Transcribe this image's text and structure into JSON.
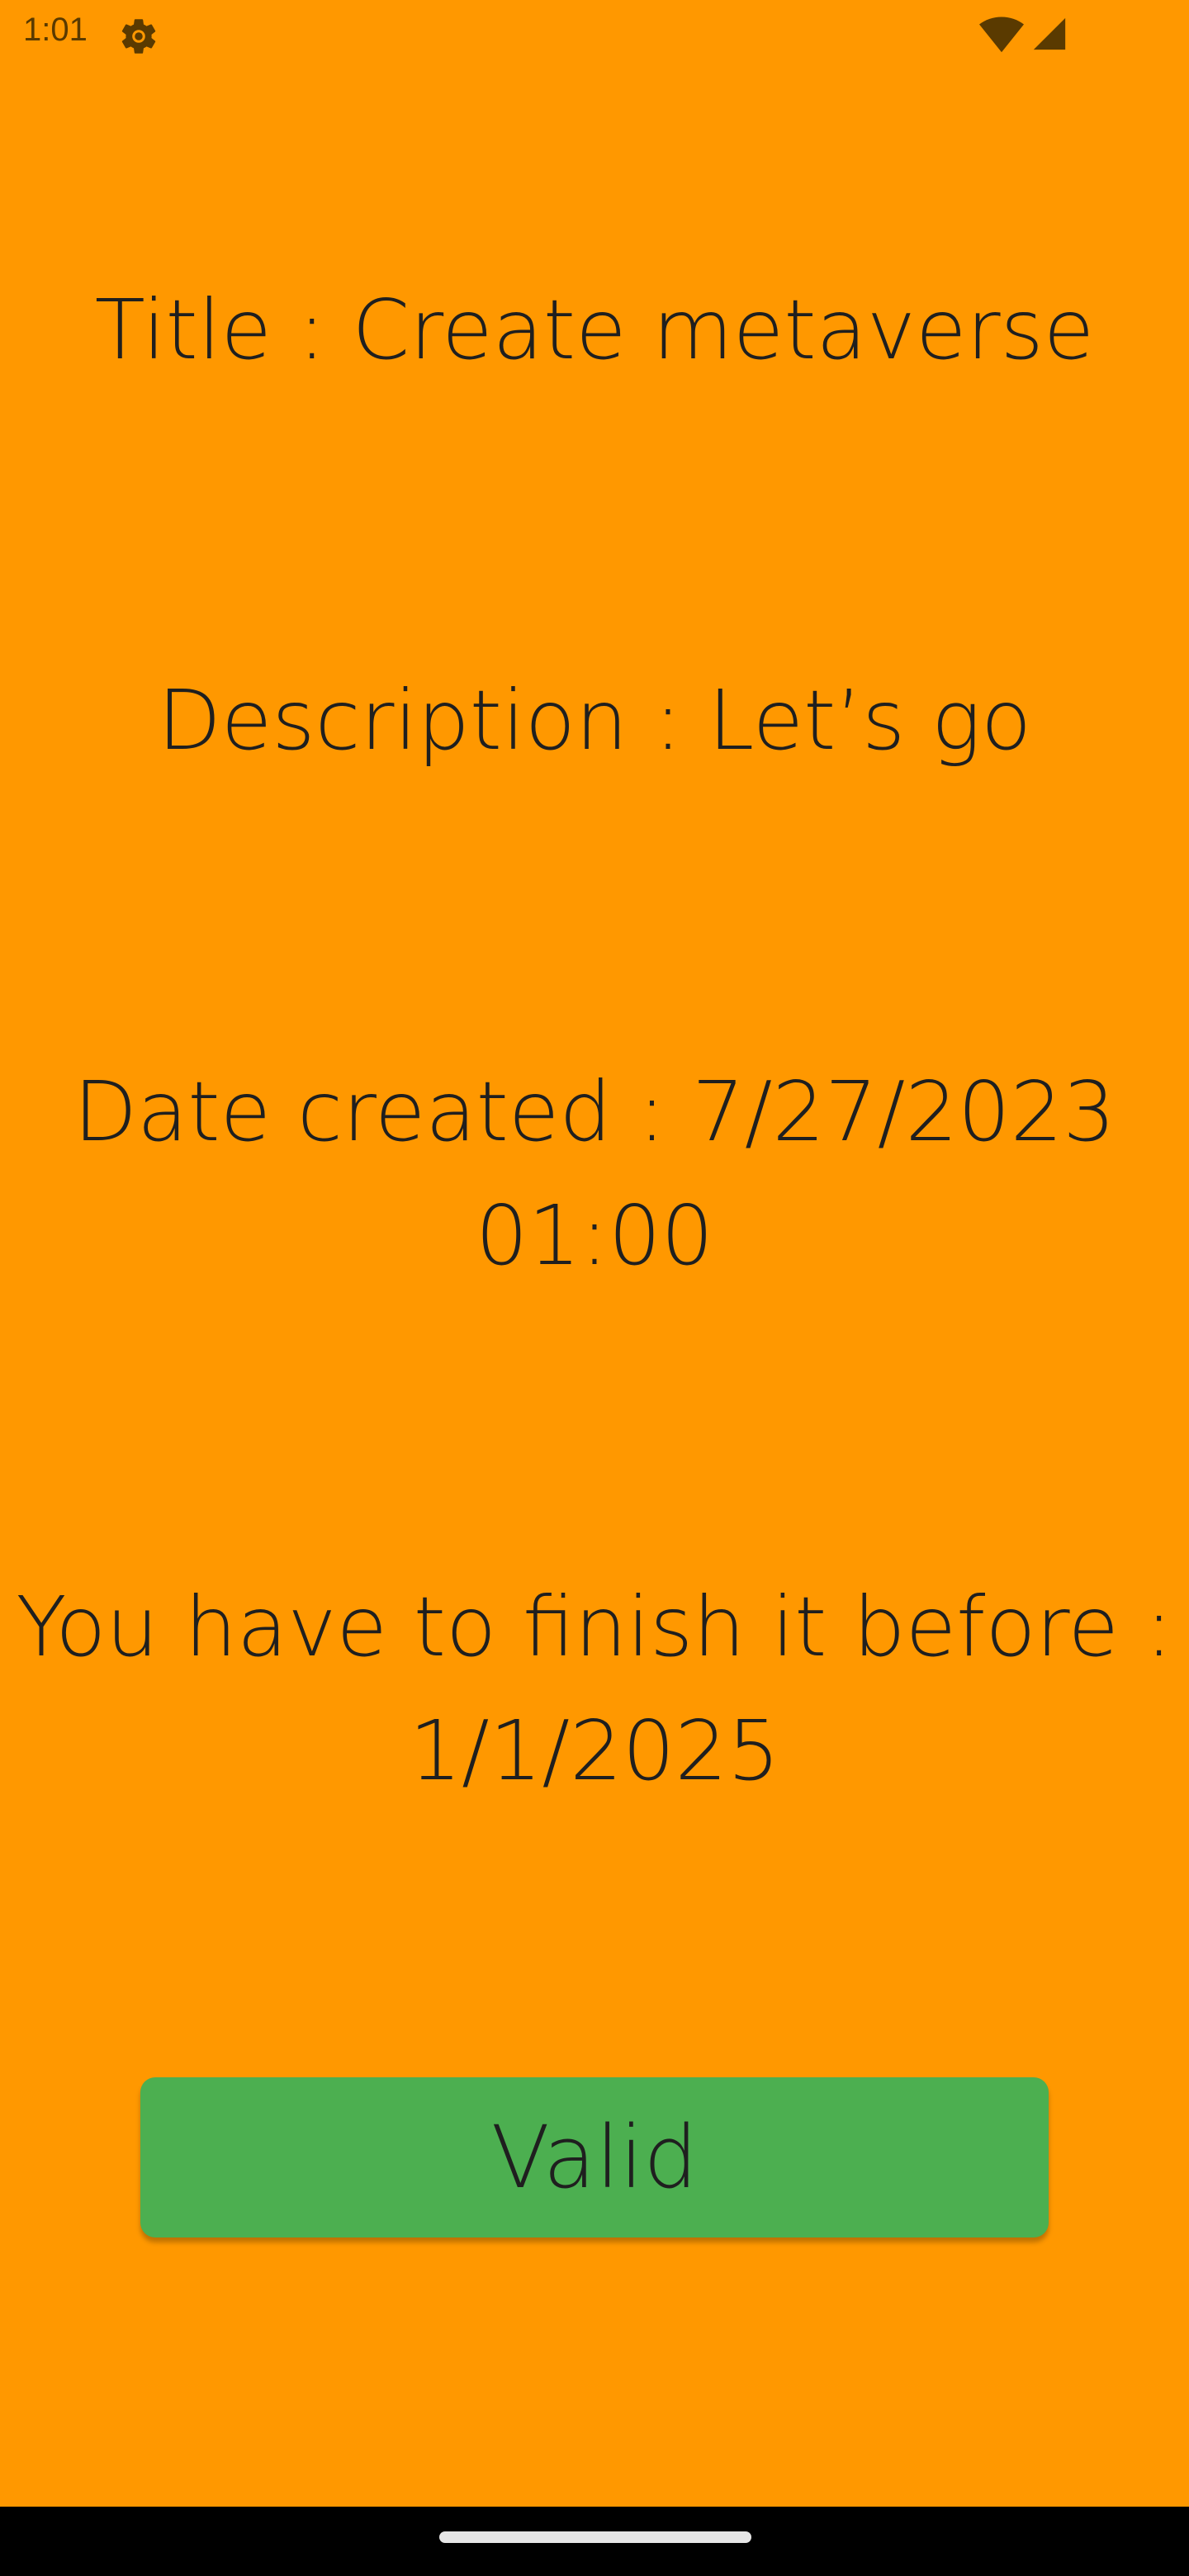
{
  "status_bar": {
    "time": "1:01",
    "icons": [
      "gear-icon",
      "wifi-icon",
      "signal-icon"
    ]
  },
  "content": {
    "title_line": "Title : Create metaverse",
    "description_line": "Description : Let’s go",
    "date_created_line1": "Date created : 7/27/2023",
    "date_created_line2": "01:00",
    "deadline_line1": "You have to finish it before :",
    "deadline_line2": "1/1/2025"
  },
  "actions": {
    "valid_label": "Valid"
  },
  "colors": {
    "background": "#ff9800",
    "button": "#4caf50",
    "text": "#1f1f1f",
    "nav_bar": "#000000"
  }
}
